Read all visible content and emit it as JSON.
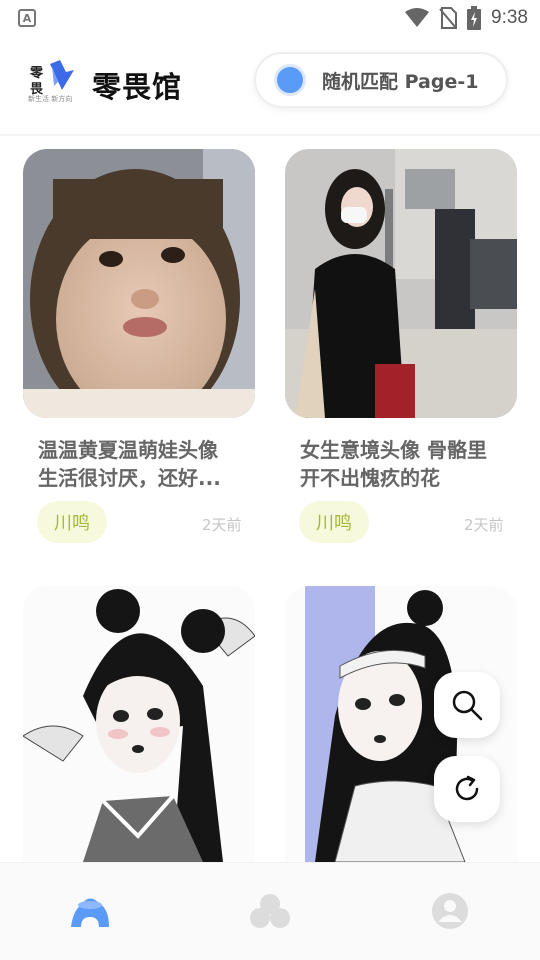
{
  "status_bar": {
    "notification_icon": "a-icon",
    "time": "9:38"
  },
  "header": {
    "logo_text": "零畏",
    "logo_tagline": "新生活 新方向",
    "title": "零畏馆",
    "random_button_label": "随机匹配  Page-1",
    "accent_color": "#5b9bf8"
  },
  "cards": [
    {
      "title_line1": "温温黄夏温萌娃头像",
      "title_line2": "生活很讨厌，还好...",
      "author": "川鸣",
      "time": "2天前",
      "image": "child-face-photo"
    },
    {
      "title_line1": "女生意境头像 骨骼里",
      "title_line2": "开不出愧疚的花",
      "author": "川鸣",
      "time": "2天前",
      "image": "girl-street-photo"
    },
    {
      "image": "anime-girl-doves-drawing"
    },
    {
      "image": "anime-girl-headband-drawing"
    }
  ],
  "fabs": [
    "search-icon",
    "refresh-icon"
  ],
  "bottom_nav": {
    "items": [
      "home-icon",
      "circles-icon",
      "profile-icon"
    ],
    "active": "home-icon"
  }
}
